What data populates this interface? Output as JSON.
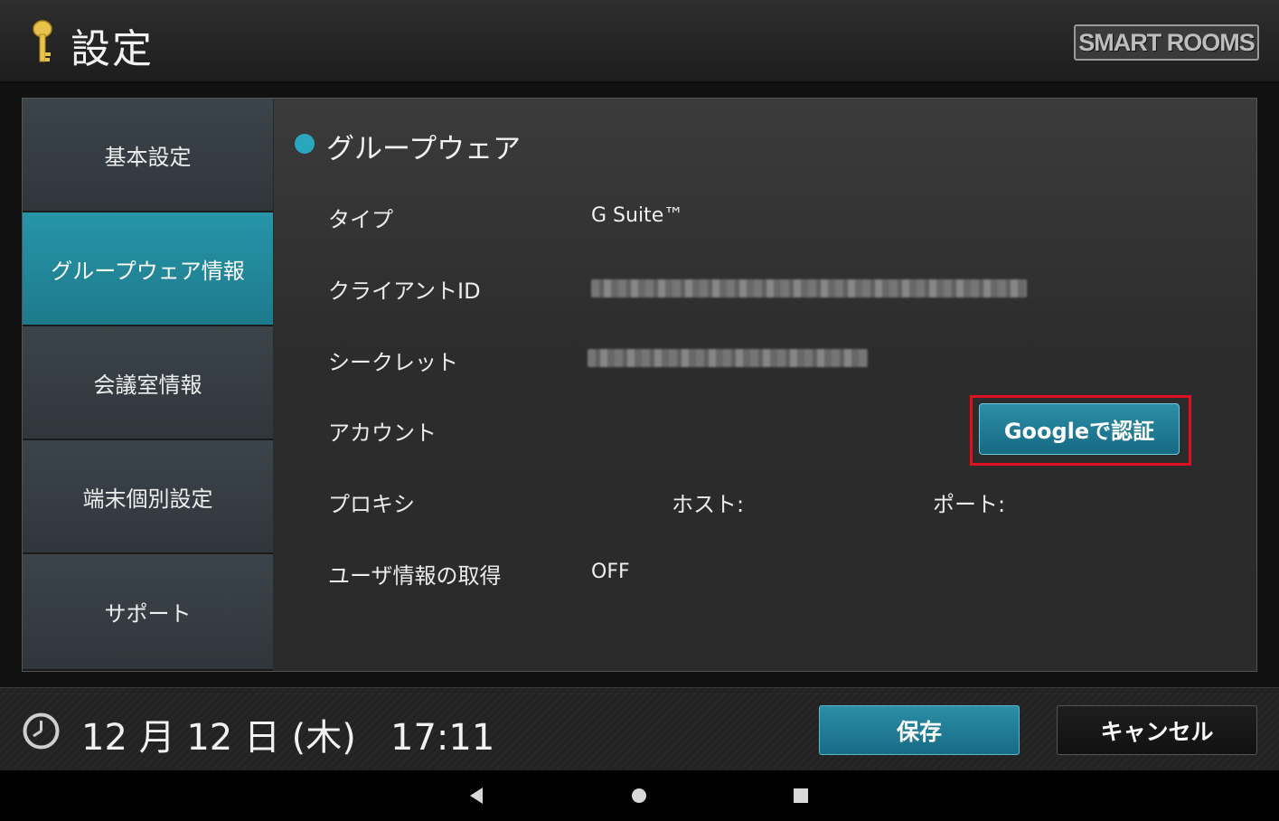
{
  "header": {
    "title": "設定",
    "key_icon": "key-icon",
    "brand_logo_text": "SMART ROOMS"
  },
  "sidebar": {
    "items": [
      {
        "label": "基本設定",
        "active": false
      },
      {
        "label": "グループウェア情報",
        "active": true
      },
      {
        "label": "会議室情報",
        "active": false
      },
      {
        "label": "端末個別設定",
        "active": false
      },
      {
        "label": "サポート",
        "active": false
      }
    ]
  },
  "content": {
    "section_title": "グループウェア",
    "rows": {
      "type": {
        "label": "タイプ",
        "value": "G Suite™"
      },
      "client_id": {
        "label": "クライアントID"
      },
      "secret": {
        "label": "シークレット"
      },
      "account": {
        "label": "アカウント",
        "button": "Googleで認証"
      },
      "proxy": {
        "label": "プロキシ",
        "host": "ホスト:",
        "port": "ポート:"
      },
      "user_info": {
        "label": "ユーザ情報の取得",
        "value": "OFF"
      }
    }
  },
  "footer": {
    "datetime": "12 月 12 日 (木)   17:11",
    "clock_icon": "clock-icon",
    "save_label": "保存",
    "cancel_label": "キャンセル"
  },
  "navbar": {
    "icons": [
      "back-icon",
      "home-icon",
      "recents-icon"
    ]
  },
  "colors": {
    "accent": "#2aa6bf",
    "highlight_border": "#e01020"
  }
}
